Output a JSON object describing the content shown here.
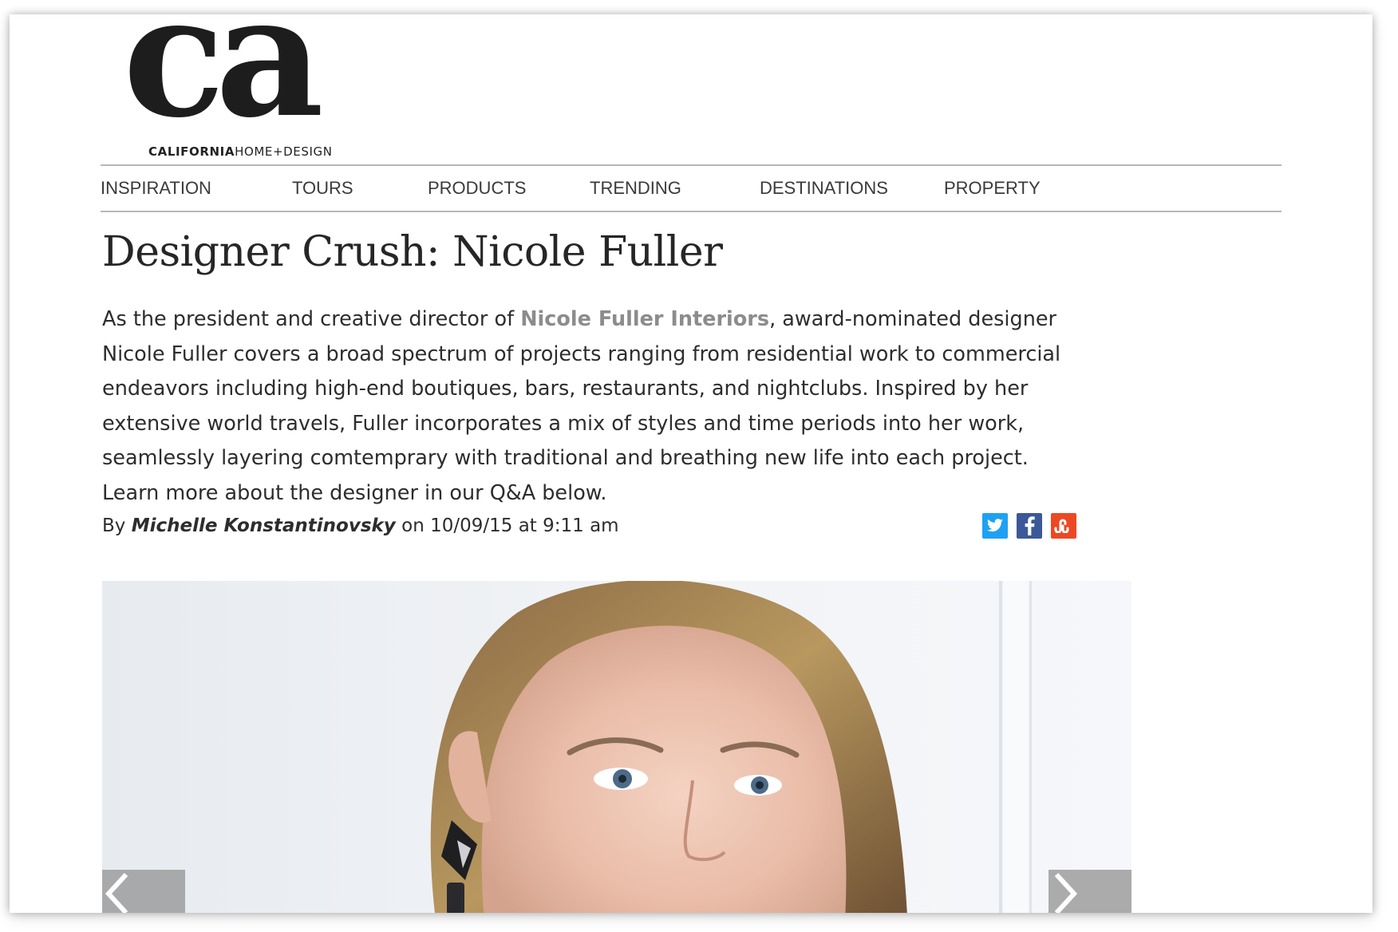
{
  "site": {
    "logo_text": "ca",
    "logo_sub_bold": "CALIFORNIA",
    "logo_sub_light": "HOME+DESIGN"
  },
  "nav": {
    "items": [
      {
        "label": "INSPIRATION"
      },
      {
        "label": "TOURS"
      },
      {
        "label": "PRODUCTS"
      },
      {
        "label": "TRENDING"
      },
      {
        "label": "DESTINATIONS"
      },
      {
        "label": "PROPERTY"
      }
    ]
  },
  "article": {
    "title": "Designer Crush: Nicole Fuller",
    "body": {
      "line1_pre": "As the president and creative director of ",
      "link_text": "Nicole Fuller Interiors",
      "line1_post": ", award-nominated designer",
      "line2": "Nicole Fuller covers a broad spectrum of projects ranging from residential work to commercial",
      "line3": "endeavors including high-end boutiques, bars, restaurants, and nightclubs. Inspired by her",
      "line4": "extensive world travels, Fuller incorporates a mix of styles and time periods into her work,",
      "line5": "seamlessly layering comtemprary with traditional and breathing new life into each project.",
      "line6": "Learn more about the designer in our Q&A below."
    },
    "byline": {
      "prefix": "By ",
      "author": "Michelle Konstantinovsky",
      "date_text": " on 10/09/15 at 9:11 am"
    }
  },
  "social": {
    "icons": [
      "twitter-icon",
      "facebook-icon",
      "stumbleupon-icon"
    ],
    "colors": {
      "twitter": "#1ea1f2",
      "facebook": "#3b5898",
      "stumbleupon": "#eb4923"
    }
  },
  "carousel": {
    "prev_icon": "chevron-left-icon",
    "next_icon": "chevron-right-icon"
  }
}
